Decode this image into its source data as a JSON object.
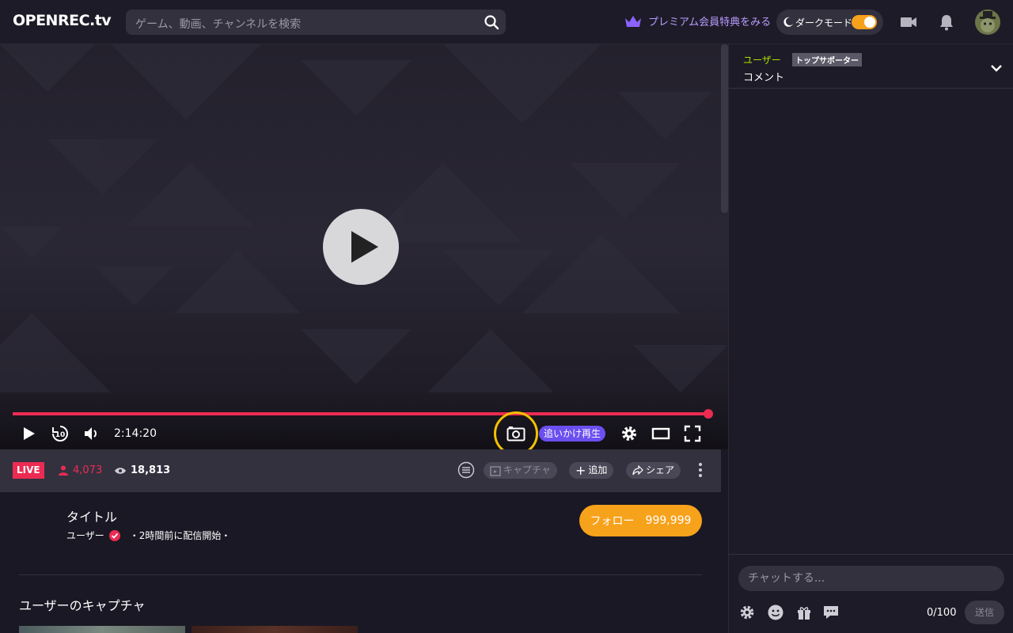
{
  "header": {
    "logo": "OPENREC.tv",
    "search_placeholder": "ゲーム、動画、チャンネルを検索",
    "premium_label": "プレミアム会員特典をみる",
    "darkmode_label": "ダークモード",
    "darkmode_on": true
  },
  "player": {
    "time": "2:14:20",
    "progress_fraction": 0.999,
    "chase_label": "追いかけ再生",
    "rewind_seconds": "10"
  },
  "infobar": {
    "live_label": "LIVE",
    "viewers": "4,073",
    "views": "18,813",
    "capture_label": "キャプチャ",
    "add_label": "追加",
    "share_label": "シェア"
  },
  "stream": {
    "title": "タイトル",
    "user": "ユーザー",
    "meta": "・2時間前に配信開始・",
    "follow_label": "フォロー",
    "follow_count": "999,999",
    "section_title": "ユーザーのキャプチャ"
  },
  "chat": {
    "user": "ユーザー",
    "badge": "トップサポーター",
    "comment": "コメント",
    "input_placeholder": "チャットする...",
    "char_count": "0/100",
    "send_label": "送信"
  },
  "colors": {
    "accent_red": "#ec2b52",
    "follow_orange": "#f7a21b",
    "premium_purple": "#b89cff",
    "chase_purple": "#6b4ff0",
    "highlight_yellow": "#f3c100"
  }
}
